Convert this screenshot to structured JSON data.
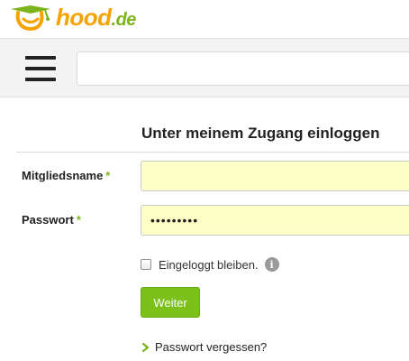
{
  "header": {
    "logo_text": "hood",
    "logo_tld": ".de",
    "logo_icon": "hood-logo-icon"
  },
  "nav": {
    "menu_icon": "hamburger-menu-icon",
    "search_value": ""
  },
  "login": {
    "title": "Unter meinem Zugang einloggen",
    "username_label": "Mitgliedsname",
    "username_value": "",
    "password_label": "Passwort",
    "password_value": "•••••••••",
    "required_marker": "*",
    "remember_label": "Eingeloggt bleiben.",
    "remember_checked": false,
    "info_icon": "info-icon",
    "submit_label": "Weiter",
    "forgot_label": "Passwort vergessen?",
    "forgot_icon": "chevron-right-icon"
  },
  "colors": {
    "brand_orange": "#f5a300",
    "brand_green": "#7cb41c",
    "button_green": "#7cc11a",
    "field_yellow": "#fdffc6"
  }
}
